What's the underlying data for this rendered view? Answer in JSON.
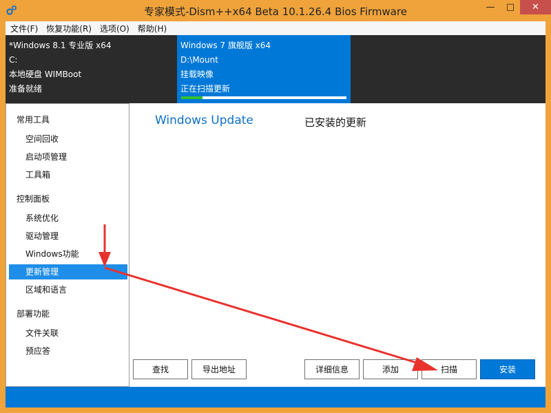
{
  "window": {
    "title": "专家模式-Dism++x64 Beta 10.1.26.4 Bios Firmware",
    "controls": {
      "minimize": "—",
      "maximize": "□",
      "close": "✕"
    },
    "accent_color": "#f0a33b"
  },
  "menu": {
    "items": [
      "文件(F)",
      "恢复功能(R)",
      "选项(O)",
      "帮助(H)"
    ]
  },
  "images": [
    {
      "lines": [
        "*Windows 8.1 专业版 x64",
        "C:",
        "本地硬盘 WIMBoot",
        "准备就绪"
      ],
      "selected": false
    },
    {
      "lines": [
        "Windows 7 旗舰版 x64",
        "D:\\Mount",
        "挂载映像",
        "正在扫描更新"
      ],
      "selected": true,
      "progress_fraction": 0.13
    }
  ],
  "sidebar": {
    "sections": [
      {
        "label": "常用工具",
        "items": [
          "空间回收",
          "启动项管理",
          "工具箱"
        ]
      },
      {
        "label": "控制面板",
        "items": [
          "系统优化",
          "驱动管理",
          "Windows功能",
          "更新管理",
          "区域和语言"
        ]
      },
      {
        "label": "部署功能",
        "items": [
          "文件关联",
          "预应答"
        ]
      }
    ],
    "selected_item": "更新管理"
  },
  "main": {
    "tabs": {
      "windows_update": "Windows Update",
      "installed": "已安装的更新"
    },
    "buttons": {
      "find": "查找",
      "export": "导出地址",
      "details": "详细信息",
      "add": "添加",
      "scan": "扫描",
      "install": "安装"
    }
  },
  "colors": {
    "selected_blue": "#1f8ee8",
    "primary_blue": "#0078d7",
    "annotation_red": "#e8322d"
  }
}
